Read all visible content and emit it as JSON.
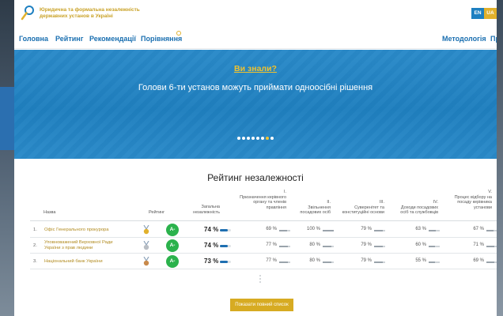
{
  "header": {
    "title_line1": "Юридична та формальна незалежність",
    "title_line2": "державних установ в Україні",
    "lang_en": "EN",
    "lang_ua": "UA"
  },
  "nav": {
    "items": [
      "Головна",
      "Рейтинг",
      "Рекомендації",
      "Порівняння"
    ],
    "right_items": [
      "Методологія",
      "Про"
    ]
  },
  "hero": {
    "kicker": "Ви знали?",
    "text": "Голови 6-ти установ можуть приймати одноосібні рішення",
    "dots_total": 8,
    "active_dot": 6
  },
  "rating": {
    "title": "Рейтинг незалежності",
    "columns": {
      "name": "Назва",
      "rating": "Рейтинг",
      "total": [
        "Загальна",
        "незалежність"
      ],
      "c1": [
        "I.",
        "Призначення керівного",
        "органу та членів",
        "правління"
      ],
      "c2": [
        "II.",
        "Звільнення",
        "посадових осіб"
      ],
      "c3": [
        "III.",
        "Суверенітет та",
        "конституційні основи"
      ],
      "c4": [
        "IV.",
        "Доходи посадових",
        "осіб та службовців"
      ],
      "c5": [
        "V.",
        "Процес відбору на",
        "посаду керівника",
        "установи"
      ]
    },
    "rows": [
      {
        "rank": "1.",
        "name": [
          "Офіс Генерального прокурора"
        ],
        "medal": "gold",
        "grade": "A-",
        "total": "74 %",
        "total_pct": 74,
        "c1": "69 %",
        "c2": "100 %",
        "c3": "79 %",
        "c4": "63 %",
        "c5": "67 %",
        "v1": 69,
        "v2": 100,
        "v3": 79,
        "v4": 63,
        "v5": 67
      },
      {
        "rank": "2.",
        "name": [
          "Уповноважений Верховної Ради",
          "України з прав людини"
        ],
        "medal": "silver",
        "grade": "A-",
        "total": "74 %",
        "total_pct": 74,
        "c1": "77 %",
        "c2": "80 %",
        "c3": "79 %",
        "c4": "60 %",
        "c5": "71 %",
        "v1": 77,
        "v2": 80,
        "v3": 79,
        "v4": 60,
        "v5": 71
      },
      {
        "rank": "3.",
        "name": [
          "Національний банк України"
        ],
        "medal": "bronze",
        "grade": "A-",
        "total": "73 %",
        "total_pct": 73,
        "c1": "77 %",
        "c2": "80 %",
        "c3": "79 %",
        "c4": "55 %",
        "c5": "69 %",
        "v1": 77,
        "v2": 80,
        "v3": 79,
        "v4": 55,
        "v5": 69
      }
    ],
    "show_all": "Показати повний список"
  },
  "colors": {
    "brand_blue": "#1e80c1",
    "accent_gold": "#d7ab22",
    "grade_green": "#2bb24c"
  }
}
